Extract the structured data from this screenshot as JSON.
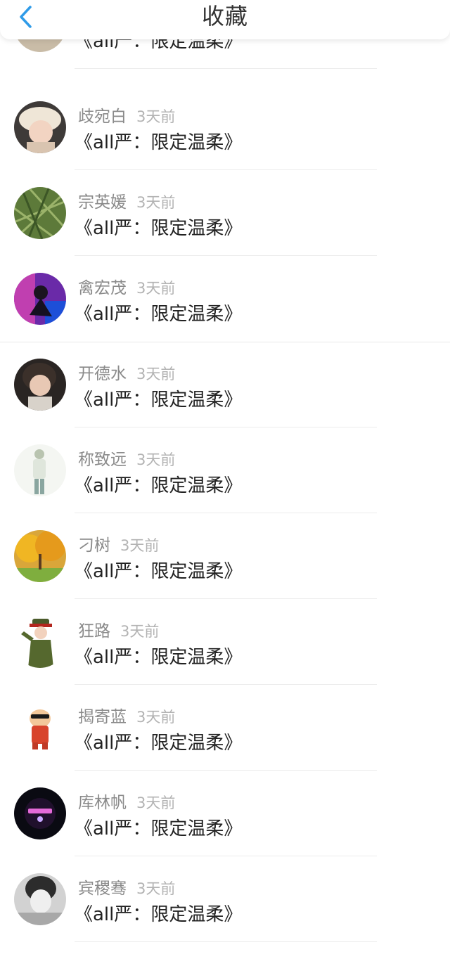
{
  "header": {
    "title": "收藏"
  },
  "partial_item": {
    "title": "《all严：限定温柔》"
  },
  "items": [
    {
      "name": "歧宛白",
      "time": "3天前",
      "title": "《all严：限定温柔》"
    },
    {
      "name": "宗英媛",
      "time": "3天前",
      "title": "《all严：限定温柔》"
    },
    {
      "name": "禽宏茂",
      "time": "3天前",
      "title": "《all严：限定温柔》"
    },
    {
      "name": "开德水",
      "time": "3天前",
      "title": "《all严：限定温柔》"
    },
    {
      "name": "称致远",
      "time": "3天前",
      "title": "《all严：限定温柔》"
    },
    {
      "name": "刁树",
      "time": "3天前",
      "title": "《all严：限定温柔》"
    },
    {
      "name": "狂路",
      "time": "3天前",
      "title": "《all严：限定温柔》"
    },
    {
      "name": "揭寄蓝",
      "time": "3天前",
      "title": "《all严：限定温柔》"
    },
    {
      "name": "库林帆",
      "time": "3天前",
      "title": "《all严：限定温柔》"
    },
    {
      "name": "宾稷骞",
      "time": "3天前",
      "title": "《all严：限定温柔》"
    }
  ],
  "colors": {
    "accent_blue": "#2f9be8",
    "name_gray": "#8a8a8a",
    "time_gray": "#b3b3b3",
    "title_dark": "#222222"
  },
  "icons": {
    "back": "chevron-left-icon"
  }
}
